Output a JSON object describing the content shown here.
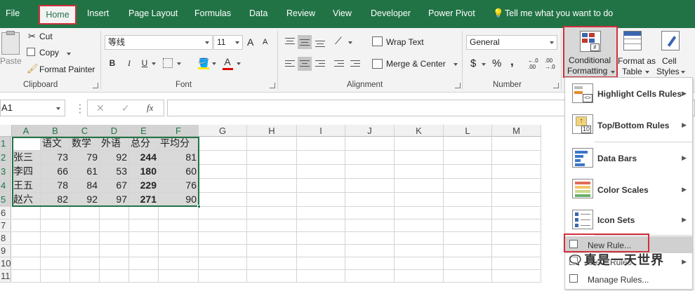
{
  "tabs": {
    "file": "File",
    "home": "Home",
    "insert": "Insert",
    "page_layout": "Page Layout",
    "formulas": "Formulas",
    "data": "Data",
    "review": "Review",
    "view": "View",
    "developer": "Developer",
    "power_pivot": "Power Pivot",
    "tell_me": "Tell me what you want to do"
  },
  "clipboard": {
    "paste": "Paste",
    "cut": "Cut",
    "copy": "Copy",
    "format_painter": "Format Painter",
    "group_label": "Clipboard"
  },
  "font": {
    "name": "等线",
    "size": "11",
    "bold": "B",
    "italic": "I",
    "underline": "U",
    "font_color_letter": "A",
    "grow": "A",
    "shrink": "A",
    "group_label": "Font"
  },
  "alignment": {
    "wrap_text": "Wrap Text",
    "merge_center": "Merge & Center",
    "group_label": "Alignment"
  },
  "number": {
    "format": "General",
    "currency": "$",
    "percent": "%",
    "comma": ",",
    "inc_decimal": "←.0\n.00",
    "dec_decimal": ".00\n→.0",
    "group_label": "Number"
  },
  "styles": {
    "conditional_formatting_l1": "Conditional",
    "conditional_formatting_l2": "Formatting",
    "format_as_table_l1": "Format as",
    "format_as_table_l2": "Table",
    "cell_styles_l1": "Cell",
    "cell_styles_l2": "Styles"
  },
  "formula_bar": {
    "name_box": "A1",
    "fx": "fx",
    "cancel": "✕",
    "enter": "✓"
  },
  "grid": {
    "columns": [
      "A",
      "B",
      "C",
      "D",
      "E",
      "F",
      "G",
      "H",
      "I",
      "J",
      "K",
      "L",
      "M"
    ],
    "rows": [
      "1",
      "2",
      "3",
      "4",
      "5",
      "6",
      "7",
      "8",
      "9",
      "10",
      "11"
    ],
    "header": [
      "",
      "语文",
      "数学",
      "外语",
      "总分",
      "平均分"
    ],
    "data": [
      [
        "张三",
        "73",
        "79",
        "92",
        "244",
        "81"
      ],
      [
        "李四",
        "66",
        "61",
        "53",
        "180",
        "60"
      ],
      [
        "王五",
        "78",
        "84",
        "67",
        "229",
        "76"
      ],
      [
        "赵六",
        "82",
        "92",
        "97",
        "271",
        "90"
      ]
    ]
  },
  "menu": {
    "highlight_cells": "Highlight Cells Rules",
    "top_bottom": "Top/Bottom Rules",
    "data_bars": "Data Bars",
    "color_scales": "Color Scales",
    "icon_sets": "Icon Sets",
    "new_rule": "New Rule...",
    "clear_rules": "Clear Rules",
    "manage_rules": "Manage Rules..."
  },
  "watermark": "真是一天世界",
  "colors": {
    "ribbon_green": "#217346",
    "highlight_red": "#d12f3a",
    "selection_gray": "#d9d9d9"
  }
}
